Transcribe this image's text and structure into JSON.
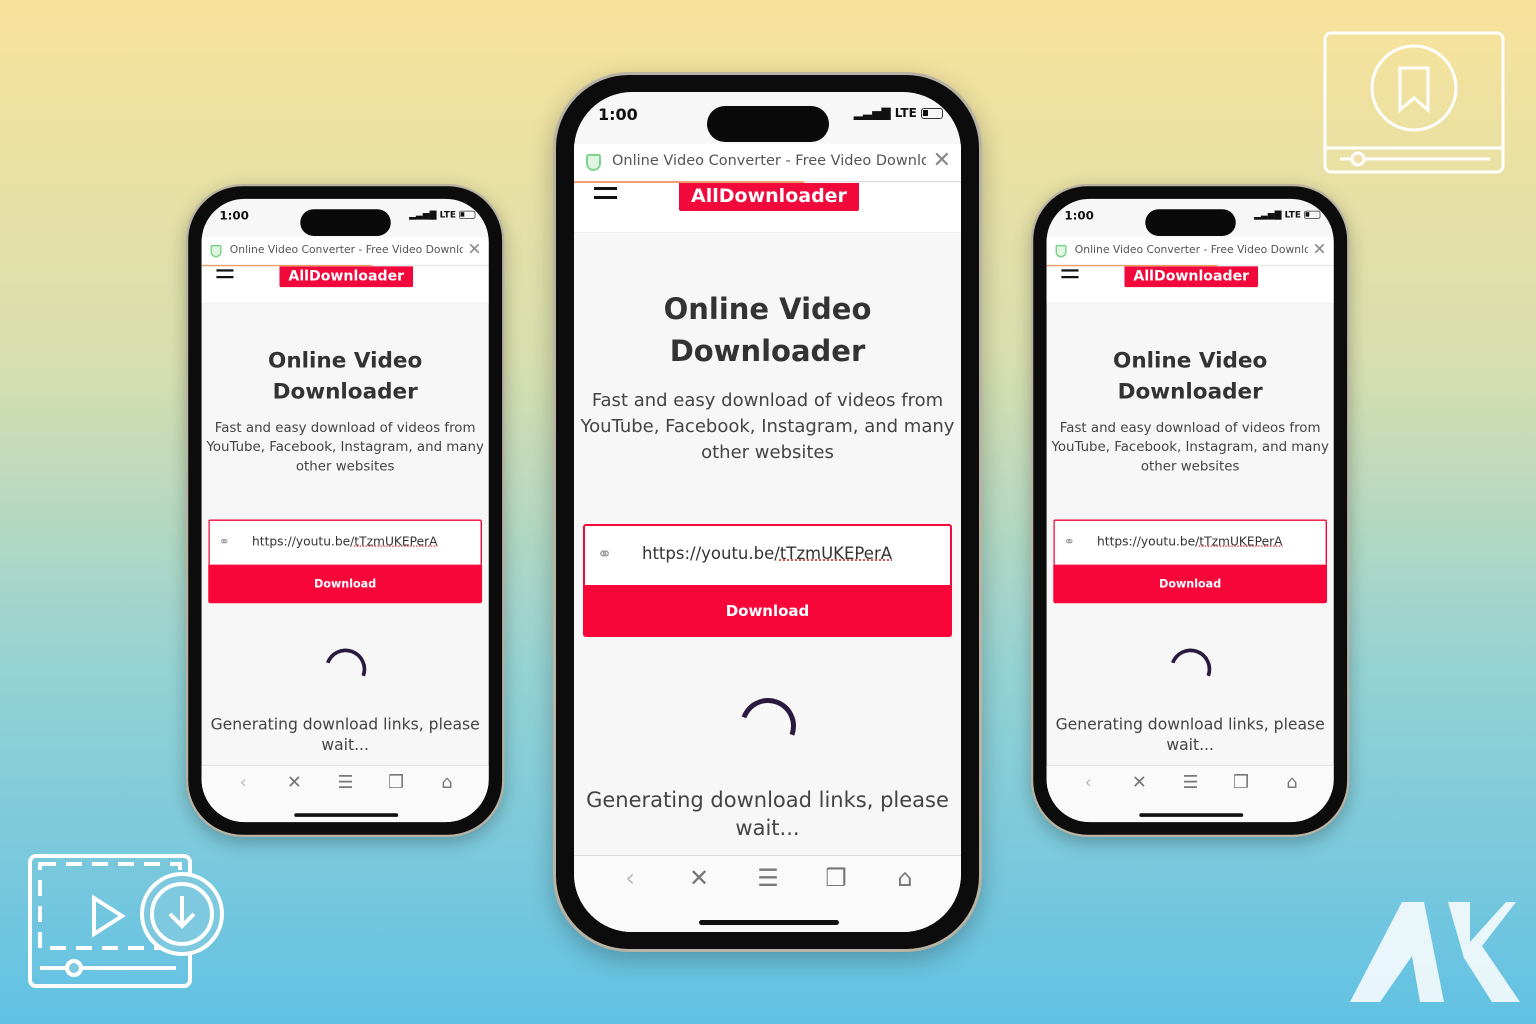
{
  "status_bar": {
    "time": "1:00",
    "network": "LTE"
  },
  "browser": {
    "tab_title": "Online Video Converter - Free Video Downlo",
    "close_icon": "close-icon"
  },
  "site": {
    "logo": "AllDownloader",
    "title_line1": "Online Video",
    "title_line2": "Downloader",
    "description": "Fast and easy download of videos from YouTube, Facebook, Instagram, and many other websites",
    "url_prefix": "https://youtu.be/",
    "url_id": "tTzmUKEPerA",
    "download_label": "Download",
    "status_message": "Generating download links, please wait...",
    "accent": "#f0093a"
  },
  "bottom_nav": [
    "back-icon",
    "close-icon",
    "menu-icon",
    "tabs-icon",
    "home-icon"
  ],
  "brand_logo": {
    "text": "AK"
  }
}
